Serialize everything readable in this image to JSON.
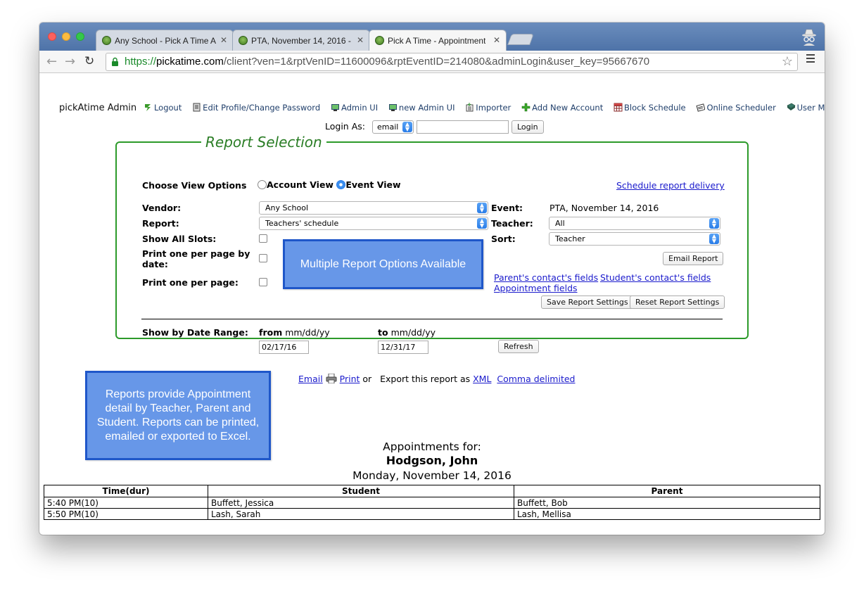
{
  "browser": {
    "tabs": [
      {
        "title": "Any School - Pick A Time A"
      },
      {
        "title": "PTA, November 14, 2016 -"
      },
      {
        "title": "Pick A Time - Appointment"
      }
    ],
    "url": {
      "scheme": "https://",
      "host": "pickatime.com",
      "rest": "/client?ven=1&rptVenID=11600096&rptEventID=214080&adminLogin&user_key=95667670"
    }
  },
  "admin_bar": {
    "brand": "pickAtime Admin",
    "links": [
      {
        "label": "Logout",
        "icon": "logout-icon"
      },
      {
        "label": "Edit Profile/Change Password",
        "icon": "profile-icon"
      },
      {
        "label": "Admin UI",
        "icon": "admin-ui-icon"
      },
      {
        "label": "new Admin UI",
        "icon": "new-admin-ui-icon"
      },
      {
        "label": "Importer",
        "icon": "importer-icon"
      },
      {
        "label": "Add New Account",
        "icon": "add-icon"
      },
      {
        "label": "Block Schedule",
        "icon": "block-schedule-icon"
      },
      {
        "label": "Online Scheduler",
        "icon": "scheduler-icon"
      },
      {
        "label": "User Manual",
        "icon": "book-icon"
      }
    ]
  },
  "login": {
    "label": "Login As:",
    "type_value": "email",
    "input_value": "",
    "button": "Login"
  },
  "report": {
    "legend": "Report Selection",
    "view_options_label": "Choose View Options",
    "account_view": "Account View",
    "event_view": "Event View",
    "schedule_delivery": "Schedule report delivery",
    "vendor_label": "Vendor:",
    "vendor_value": "Any School",
    "report_label": "Report:",
    "report_value": "Teachers' schedule",
    "show_all_slots": "Show All Slots:",
    "print_per_date": "Print one per page by date:",
    "print_per_page": "Print one per page:",
    "event_label": "Event:",
    "event_value": "PTA, November 14, 2016",
    "teacher_label": "Teacher:",
    "teacher_value": "All",
    "sort_label": "Sort:",
    "sort_value": "Teacher",
    "email_report": "Email Report",
    "parent_fields": "Parent's contact's fields",
    "student_fields": "Student's contact's fields",
    "appointment_fields": "Appointment fields",
    "save_settings": "Save Report Settings",
    "reset_settings": "Reset Report Settings",
    "date_range_label": "Show by Date Range:",
    "from_label": "from",
    "from_hint": "mm/dd/yy",
    "from_value": "02/17/16",
    "to_label": "to",
    "to_hint": "mm/dd/yy",
    "to_value": "12/31/17",
    "refresh": "Refresh"
  },
  "callouts": {
    "options": "Multiple Report Options Available",
    "reports": "Reports provide Appointment detail by Teacher, Parent and Student. Reports can be printed, emailed or exported to Excel."
  },
  "export": {
    "email": "Email",
    "print": "Print",
    "or": "or",
    "export_text": "Export this report as",
    "xml": "XML",
    "csv": "Comma delimited"
  },
  "appointments": {
    "heading": "Appointments for:",
    "teacher": "Hodgson, John",
    "date": "Monday, November 14, 2016",
    "columns": [
      "Time(dur)",
      "Student",
      "Parent"
    ],
    "rows": [
      [
        "5:40 PM(10)",
        "Buffett, Jessica",
        "Buffett, Bob"
      ],
      [
        "5:50 PM(10)",
        "Lash, Sarah",
        "Lash, Mellisa"
      ]
    ]
  }
}
